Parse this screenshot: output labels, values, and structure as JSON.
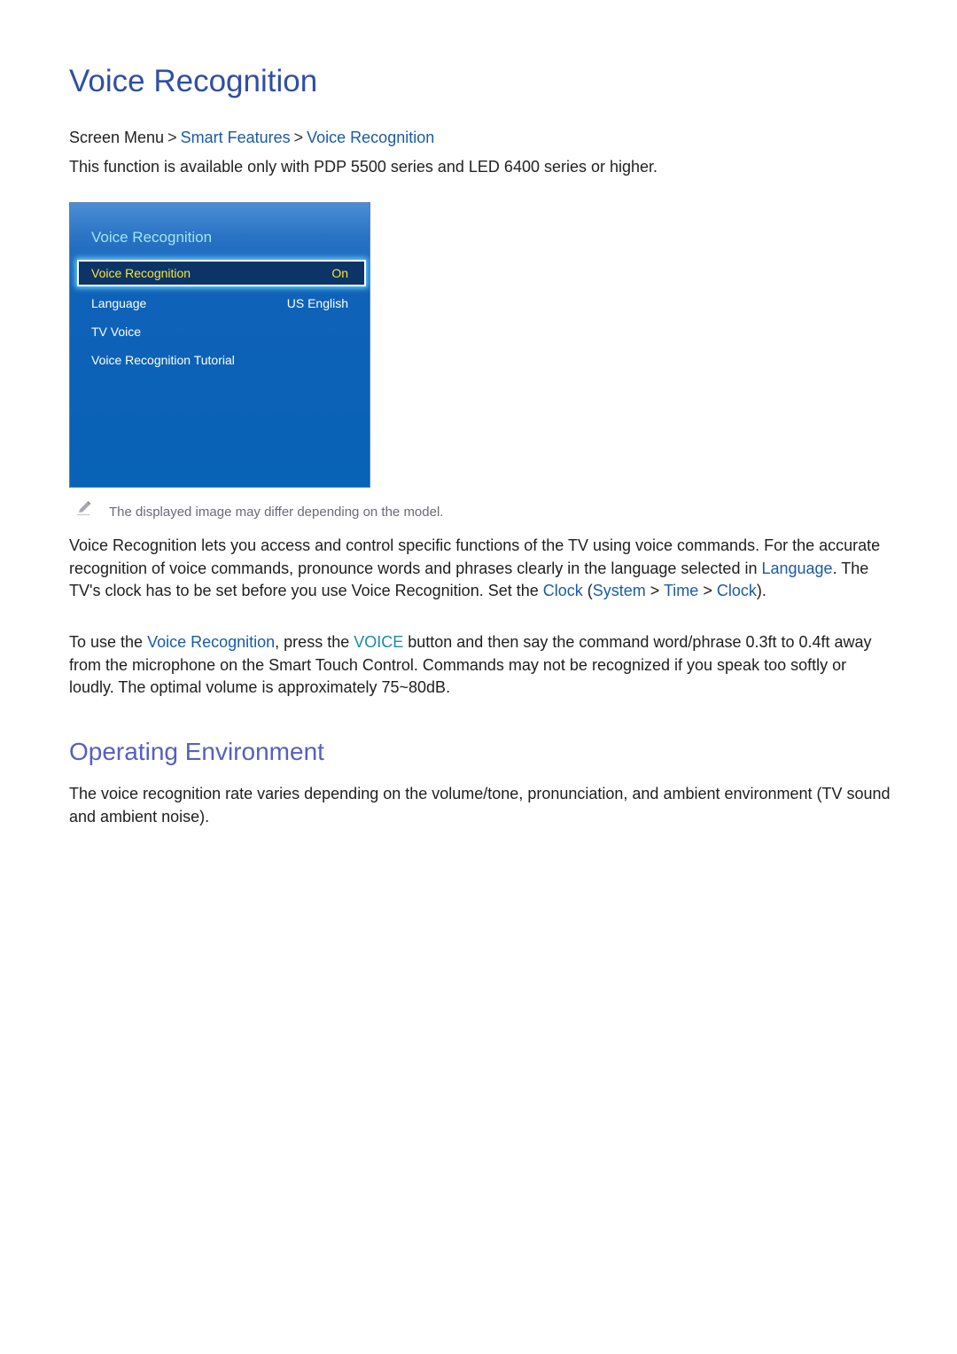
{
  "header": {
    "title": "Voice Recognition"
  },
  "breadcrumb": {
    "items": [
      "Screen Menu",
      "Smart Features",
      "Voice Recognition"
    ],
    "separator": ">"
  },
  "availability": "This function is available only with PDP 5500 series and LED 6400 series or higher.",
  "tv_menu": {
    "title": "Voice Recognition",
    "items": [
      {
        "label": "Voice Recognition",
        "value": "On",
        "selected": true
      },
      {
        "label": "Language",
        "value": "US English",
        "selected": false
      },
      {
        "label": "TV Voice",
        "value": "",
        "selected": false
      },
      {
        "label": "Voice Recognition Tutorial",
        "value": "",
        "selected": false
      }
    ],
    "colors": {
      "panel": "#0862b6",
      "title": "#9fe6f2",
      "selected_text": "#f5e43a",
      "selected_bg": "#0c3466"
    }
  },
  "note": {
    "icon": "pencil-icon",
    "text": "The displayed image may differ depending on the model."
  },
  "paragraph1": {
    "t1": "Voice Recognition lets you access and control specific functions of the TV using voice commands. For the accurate recognition of voice commands, pronounce words and phrases clearly in the language selected in ",
    "link_language": "Language",
    "t2": ". The TV's clock has to be set before you use Voice Recognition. Set the ",
    "link_clock": "Clock",
    "t3": " (",
    "link_system": "System",
    "sep1": " > ",
    "link_time": "Time",
    "sep2": " > ",
    "link_clock2": "Clock",
    "t4": ")."
  },
  "paragraph2": {
    "t1": "To use the ",
    "link_voice_recognition": "Voice Recognition",
    "t2": ", press the ",
    "voice_button": "VOICE",
    "t3": " button and then say the command word/phrase 0.3ft to 0.4ft away from the microphone on the Smart Touch Control. Commands may not be recognized if you speak too softly or loudly. The optimal volume is approximately 75~80dB."
  },
  "section2": {
    "title": "Operating Environment",
    "text": "The voice recognition rate varies depending on the volume/tone, pronunciation, and ambient environment (TV sound and ambient noise)."
  },
  "colors": {
    "title": "#2f4fa5",
    "subtitle": "#5560c0",
    "link": "#1a5aa8",
    "voice_key": "#1a8aa8",
    "note_text": "#6a6a78"
  }
}
